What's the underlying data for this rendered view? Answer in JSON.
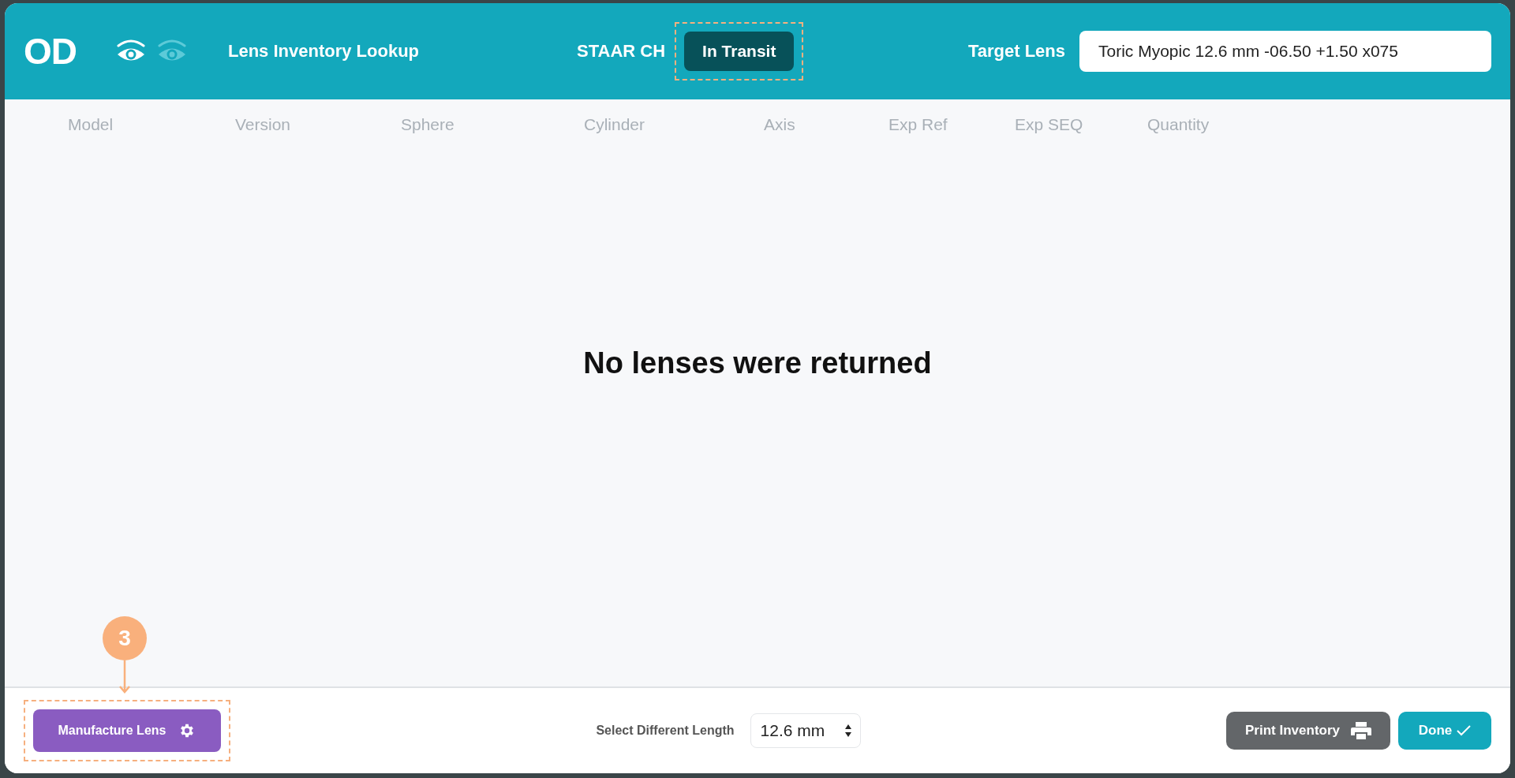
{
  "eye": {
    "label": "OD"
  },
  "eye_toggles": [
    {
      "selected": true
    },
    {
      "selected": false
    }
  ],
  "title": "Lens Inventory Lookup",
  "manufacturer": "STAAR CH",
  "status_button": {
    "label": "In Transit",
    "highlighted": true
  },
  "target_lens": {
    "label": "Target Lens",
    "value": "Toric Myopic 12.6 mm -06.50 +1.50 x075"
  },
  "table": {
    "columns": [
      "Model",
      "Version",
      "Sphere",
      "Cylinder",
      "Axis",
      "Exp Ref",
      "Exp SEQ",
      "Quantity"
    ]
  },
  "empty_message": "No lenses were returned",
  "footer": {
    "manufacture_button": {
      "label": "Manufacture Lens",
      "highlighted": true,
      "callout": "3"
    },
    "length": {
      "label": "Select Different Length",
      "value": "12.6 mm"
    },
    "print_button": {
      "label": "Print Inventory"
    },
    "done_button": {
      "label": "Done"
    }
  }
}
